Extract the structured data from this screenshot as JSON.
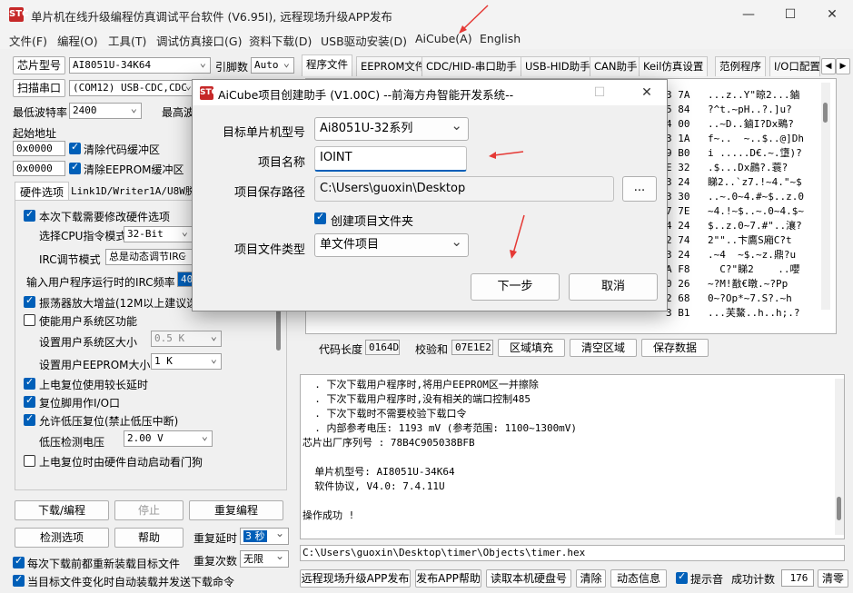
{
  "window": {
    "title": "单片机在线升级编程仿真调试平台软件 (V6.95I), 远程现场升级APP发布",
    "icon_label": "STC",
    "minimize": "—",
    "maximize": "☐",
    "close": "✕"
  },
  "menu": [
    "文件(F)",
    "编程(O)",
    "工具(T)",
    "调试仿真接口(G)",
    "资料下载(D)",
    "USB驱动安装(D)",
    "AiCube(A)",
    "English"
  ],
  "left": {
    "chip_btn": "芯片型号",
    "chip_value": "AI8051U-34K64",
    "pins_label": "引脚数",
    "pins_value": "Auto",
    "scan_btn": "扫描串口",
    "port_value": "(COM12) USB-CDC,CDC",
    "min_baud_label": "最低波特率",
    "min_baud_value": "2400",
    "max_baud_label": "最高波",
    "start_addr_label": "起始地址",
    "addr1": "0x0000",
    "clear_code": "清除代码缓冲区",
    "addr2": "0x0000",
    "clear_eeprom": "清除EEPROM缓冲区",
    "hw_tab": "硬件选项",
    "hw_tab2": "Link1D/Writer1A/U8W脱机",
    "opt_modify_hw": "本次下载需要修改硬件选项",
    "cpu_mode_label": "选择CPU指令模式",
    "cpu_mode_value": "32-Bit",
    "irc_label": "IRC调节模式",
    "irc_value": "总是动态调节IRC",
    "irc_freq_label": "输入用户程序运行时的IRC频率",
    "irc_freq_value": "40",
    "opt_osc": "振荡器放大增益(12M以上建议选",
    "opt_user_sys": "使能用户系统区功能",
    "user_sys_size_label": "设置用户系统区大小",
    "user_sys_size_value": "0.5 K",
    "eeprom_size_label": "设置用户EEPROM大小",
    "eeprom_size_value": "1   K",
    "opt_power_delay": "上电复位使用较长延时",
    "opt_reset_io": "复位脚用作I/O口",
    "opt_lvr": "允许低压复位(禁止低压中断)",
    "lvd_label": "低压检测电压",
    "lvd_value": "2.00 V",
    "opt_watchdog": "上电复位时由硬件自动启动看门狗",
    "download_btn": "下载/编程",
    "stop_btn": "停止",
    "reprogram_btn": "重复编程",
    "detect_btn": "检测选项",
    "help_btn": "帮助",
    "repeat_delay_label": "重复延时",
    "repeat_delay_value": "3 秒",
    "repeat_count_label": "重复次数",
    "repeat_count_value": "无限",
    "opt_reload": "每次下载前都重新装载目标文件",
    "opt_autosend": "当目标文件变化时自动装载并发送下载命令"
  },
  "tabs": [
    "程序文件",
    "EEPROM文件",
    "CDC/HID-串口助手",
    "USB-HID助手",
    "CAN助手",
    "Keil仿真设置",
    "范例程序",
    "I/O口配置"
  ],
  "hex": [
    {
      "h": "3 7A",
      "a": "...z..Y\"晾2...鏀"
    },
    {
      "h": "5 84",
      "a": "?^t.~pH..?.]u?"
    },
    {
      "h": "4 00",
      "a": "..~D..鏀I?Dx鵐?"
    },
    {
      "h": "3 1A",
      "a": "f~..  ~..$..@]Dh"
    },
    {
      "h": "9 B0",
      "a": "i .....D€.~.墯)?"
    },
    {
      "h": "E 32",
      "a": ".$...Dx鷐?.蓑?"
    },
    {
      "h": "3 24",
      "a": "睇2..`z7.!~4.\"~$"
    },
    {
      "h": "3 30",
      "a": "..~.0~4.#~$..z.0"
    },
    {
      "h": "7 7E",
      "a": "~4.!~$..~.0~4.$~"
    },
    {
      "h": "4 24",
      "a": "$..z.0~7.#\"..瀼?"
    },
    {
      "h": "2 74",
      "a": "2\"\"..卞鷹S廂C?t"
    },
    {
      "h": "3 24",
      "a": ".~4  ~$.~z.鼎?u"
    },
    {
      "h": "A F8",
      "a": "  C?\"睇2    ..嚶"
    },
    {
      "h": "0 26",
      "a": "~?M!敾€暾.~?Pp"
    },
    {
      "h": "2 68",
      "a": "0~?Op*~7.S?.~h"
    },
    {
      "h": "3 B1",
      "a": "...芙鰲..h..h;.?"
    }
  ],
  "code_bar": {
    "len_label": "代码长度",
    "len_value": "0164D",
    "sum_label": "校验和",
    "sum_value": "07E1E2",
    "fill_btn": "区域填充",
    "clear_btn": "清空区域",
    "save_btn": "保存数据"
  },
  "log": [
    "  . 下次下载用户程序时,将用户EEPROM区一并擦除",
    "  . 下次下载用户程序时,没有相关的端口控制485",
    "  . 下次下载时不需要校验下载口令",
    "  . 内部参考电压: 1193 mV (参考范围: 1100~1300mV)",
    "芯片出厂序列号 : 78B4C905038BFB",
    "",
    "  单片机型号: AI8051U-34K64",
    "  软件协议, V4.0: 7.4.11U",
    "",
    "操作成功 !"
  ],
  "path": "C:\\Users\\guoxin\\Desktop\\timer\\Objects\\timer.hex",
  "bottom": {
    "publish_btn": "远程现场升级APP发布",
    "publish_help_btn": "发布APP帮助",
    "read_disk_btn": "读取本机硬盘号",
    "clear_btn": "清除",
    "anim_btn": "动态信息",
    "beep_label": "提示音",
    "success_label": "成功计数",
    "success_value": "176",
    "zero_btn": "清零"
  },
  "dialog": {
    "icon_label": "STC",
    "title": "AiCube项目创建助手 (V1.00C) --前海方舟智能开发系统--",
    "target_label": "目标单片机型号",
    "target_value": "Ai8051U-32系列",
    "name_label": "项目名称",
    "name_value": "IOINT",
    "path_label": "项目保存路径",
    "path_value": "C:\\Users\\guoxin\\Desktop",
    "browse_btn": "...",
    "create_folder": "创建项目文件夹",
    "type_label": "项目文件类型",
    "type_value": "单文件项目",
    "next_btn": "下一步",
    "cancel_btn": "取消",
    "min": "—",
    "max": "☐",
    "close": "✕"
  },
  "colors": {
    "accent": "#005fb8",
    "annotation_arrow": "#e53935"
  }
}
